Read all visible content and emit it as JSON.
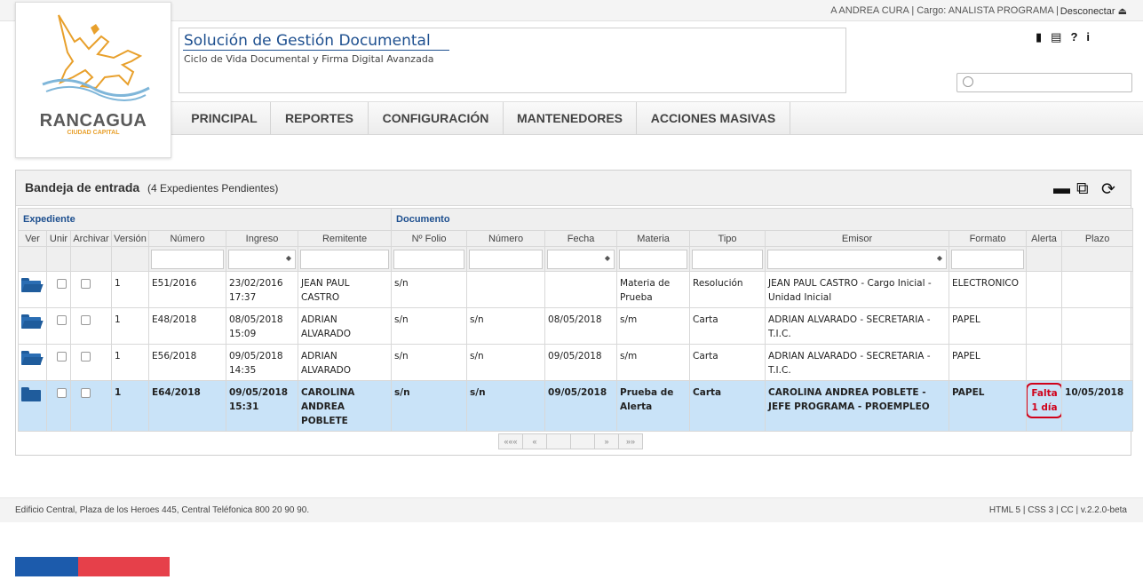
{
  "topbar": {
    "user_text": "A ANDREA CURA | Cargo: ANALISTA PROGRAMA |",
    "logout_label": "Desconectar",
    "logout_icon": "logout-icon"
  },
  "logo": {
    "city": "RANCAGUA",
    "tagline": "CIUDAD CAPITAL",
    "accent_color": "#e8a02c"
  },
  "header": {
    "title": "Solución de Gestión Documental",
    "subtitle": "Ciclo de Vida Documental y Firma Digital Avanzada"
  },
  "toolbar": {
    "icons": [
      "book-icon",
      "news-icon",
      "help-icon",
      "info-icon"
    ],
    "book_glyph": "▮",
    "news_glyph": "▤",
    "help_glyph": "?",
    "info_glyph": "i"
  },
  "search": {
    "placeholder": ""
  },
  "nav": {
    "items": [
      {
        "label": "PRINCIPAL"
      },
      {
        "label": "REPORTES"
      },
      {
        "label": "CONFIGURACIÓN"
      },
      {
        "label": "MANTENEDORES"
      },
      {
        "label": "ACCIONES MASIVAS"
      }
    ]
  },
  "panel": {
    "title": "Bandeja de entrada",
    "count": "(4 Expedientes Pendientes)",
    "actions": [
      "archive-icon",
      "copy-icon",
      "refresh-icon"
    ]
  },
  "table": {
    "groups": {
      "expediente": "Expediente",
      "documento": "Documento"
    },
    "columns": [
      "Ver",
      "Unir",
      "Archivar",
      "Versión",
      "Número",
      "Ingreso",
      "Remitente",
      "Nº Folio",
      "Número",
      "Fecha",
      "Materia",
      "Tipo",
      "Emisor",
      "Formato",
      "Alerta",
      "Plazo"
    ],
    "rows": [
      {
        "version": "1",
        "numero": "E51/2016",
        "ingreso": "23/02/2016 17:37",
        "remitente": "JEAN PAUL CASTRO",
        "folio": "s/n",
        "doc_numero": "",
        "fecha": "",
        "materia": "Materia de Prueba",
        "tipo": "Resolución",
        "emisor": "JEAN PAUL CASTRO - Cargo Inicial - Unidad Inicial",
        "formato": "ELECTRONICO",
        "alerta": "",
        "plazo": ""
      },
      {
        "version": "1",
        "numero": "E48/2018",
        "ingreso": "08/05/2018 15:09",
        "remitente": "ADRIAN ALVARADO",
        "folio": "s/n",
        "doc_numero": "s/n",
        "fecha": "08/05/2018",
        "materia": "s/m",
        "tipo": "Carta",
        "emisor": "ADRIAN ALVARADO - SECRETARIA - T.I.C.",
        "formato": "PAPEL",
        "alerta": "",
        "plazo": ""
      },
      {
        "version": "1",
        "numero": "E56/2018",
        "ingreso": "09/05/2018 14:35",
        "remitente": "ADRIAN ALVARADO",
        "folio": "s/n",
        "doc_numero": "s/n",
        "fecha": "09/05/2018",
        "materia": "s/m",
        "tipo": "Carta",
        "emisor": "ADRIAN ALVARADO - SECRETARIA - T.I.C.",
        "formato": "PAPEL",
        "alerta": "",
        "plazo": ""
      },
      {
        "version": "1",
        "numero": "E64/2018",
        "ingreso": "09/05/2018 15:31",
        "remitente": "CAROLINA ANDREA POBLETE",
        "folio": "s/n",
        "doc_numero": "s/n",
        "fecha": "09/05/2018",
        "materia": "Prueba de Alerta",
        "tipo": "Carta",
        "emisor": "CAROLINA ANDREA POBLETE - JEFE PROGRAMA - PROEMPLEO",
        "formato": "PAPEL",
        "alerta": "Falta 1 día",
        "plazo": "10/05/2018"
      }
    ]
  },
  "pager": {
    "first": "«««",
    "prev": "«",
    "next": "»",
    "last": "»»"
  },
  "footer": {
    "address": "Edificio Central, Plaza de los Heroes 445, Central Teléfonica 800 20 90 90.",
    "version": "HTML 5 | CSS 3 | CC | v.2.2.0-beta"
  },
  "colors": {
    "blue": "#1c5bac",
    "red": "#e6404a",
    "alert": "#d0021b",
    "selected_row": "#c9e3f8"
  }
}
